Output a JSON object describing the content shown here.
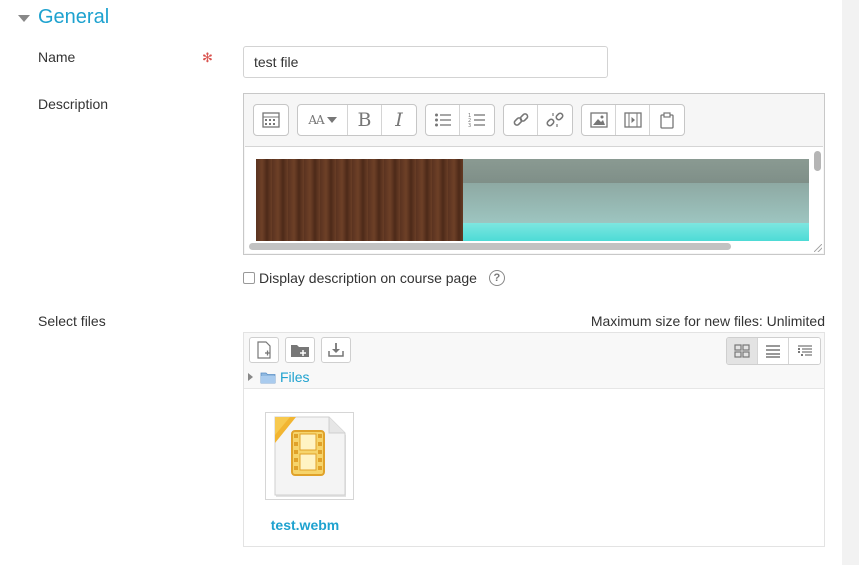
{
  "section": {
    "title": "General"
  },
  "name_field": {
    "label": "Name",
    "value": "test file",
    "required_marker": "✻"
  },
  "description": {
    "label": "Description"
  },
  "editor_toolbar": [
    {
      "group": "collapse",
      "buttons": [
        "toolbar-toggle-icon"
      ]
    },
    {
      "group": "style",
      "buttons": [
        "font-style-icon",
        "bold-icon",
        "italic-icon"
      ]
    },
    {
      "group": "list",
      "buttons": [
        "unordered-list-icon",
        "ordered-list-icon"
      ]
    },
    {
      "group": "links",
      "buttons": [
        "link-icon",
        "unlink-icon"
      ]
    },
    {
      "group": "insert",
      "buttons": [
        "image-icon",
        "media-icon",
        "manage-files-icon"
      ]
    }
  ],
  "toolbar_labels": {
    "style": "AA",
    "bold": "B",
    "italic": "I"
  },
  "display_description": {
    "label": "Display description on course page",
    "checked": false
  },
  "select_files": {
    "label": "Select files",
    "max_size": "Maximum size for new files: Unlimited",
    "path_label": "Files",
    "files": [
      {
        "name": "test.webm",
        "type": "video"
      }
    ],
    "view_mode": "icons"
  },
  "colors": {
    "accent": "#1ea2cf",
    "required": "#d9534f"
  }
}
